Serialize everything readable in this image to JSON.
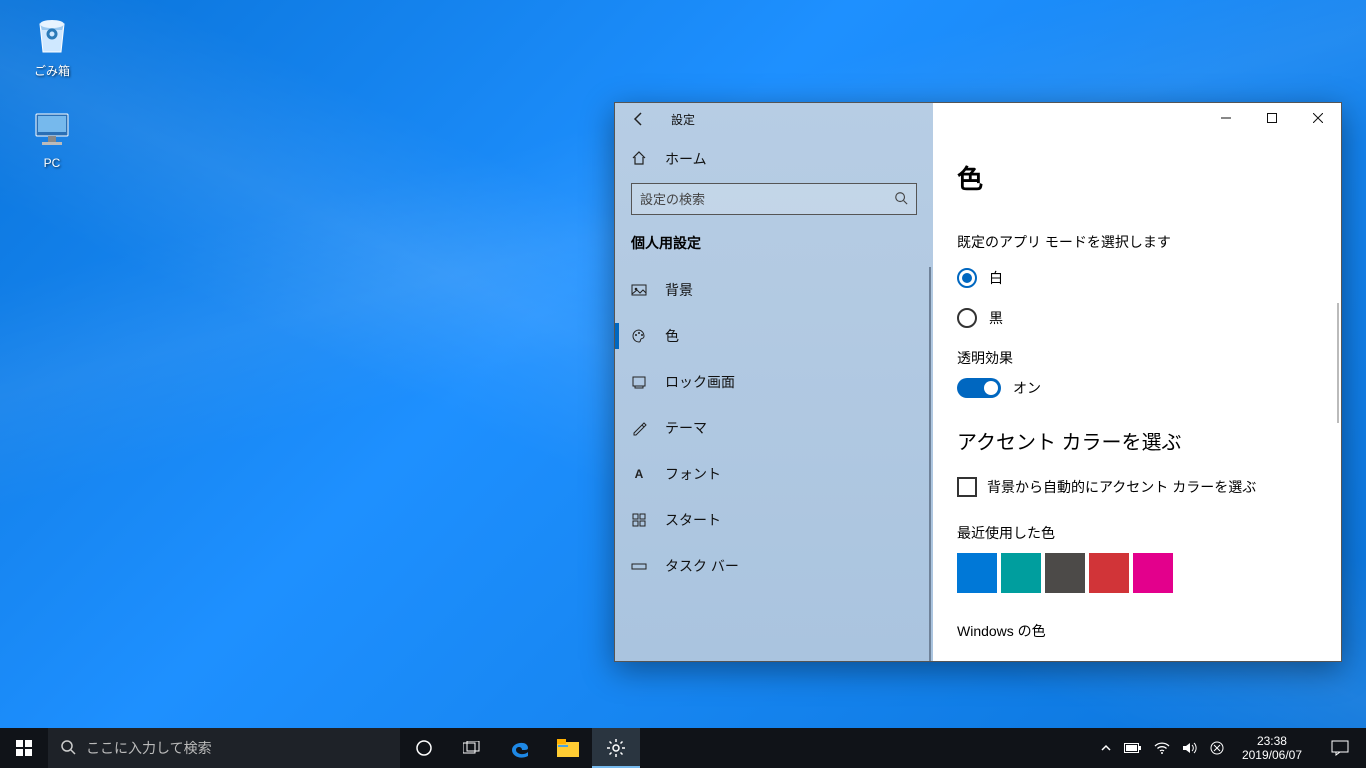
{
  "desktop": {
    "recycle_label": "ごみ箱",
    "pc_label": "PC"
  },
  "settings": {
    "title": "設定",
    "home": "ホーム",
    "search_placeholder": "設定の検索",
    "section": "個人用設定",
    "nav": [
      {
        "label": "背景"
      },
      {
        "label": "色"
      },
      {
        "label": "ロック画面"
      },
      {
        "label": "テーマ"
      },
      {
        "label": "フォント"
      },
      {
        "label": "スタート"
      },
      {
        "label": "タスク バー"
      }
    ]
  },
  "page": {
    "title": "色",
    "app_mode_heading": "既定のアプリ モードを選択します",
    "radio_light": "白",
    "radio_dark": "黒",
    "transparency_label": "透明効果",
    "transparency_value": "オン",
    "accent_heading": "アクセント カラーを選ぶ",
    "auto_accent": "背景から自動的にアクセント カラーを選ぶ",
    "recent_label": "最近使用した色",
    "recent_colors": [
      "#0078d7",
      "#009e9e",
      "#4c4a48",
      "#d13438",
      "#e3008c"
    ],
    "windows_colors_label": "Windows の色"
  },
  "taskbar": {
    "search_placeholder": "ここに入力して検索",
    "time": "23:38",
    "date": "2019/06/07"
  }
}
